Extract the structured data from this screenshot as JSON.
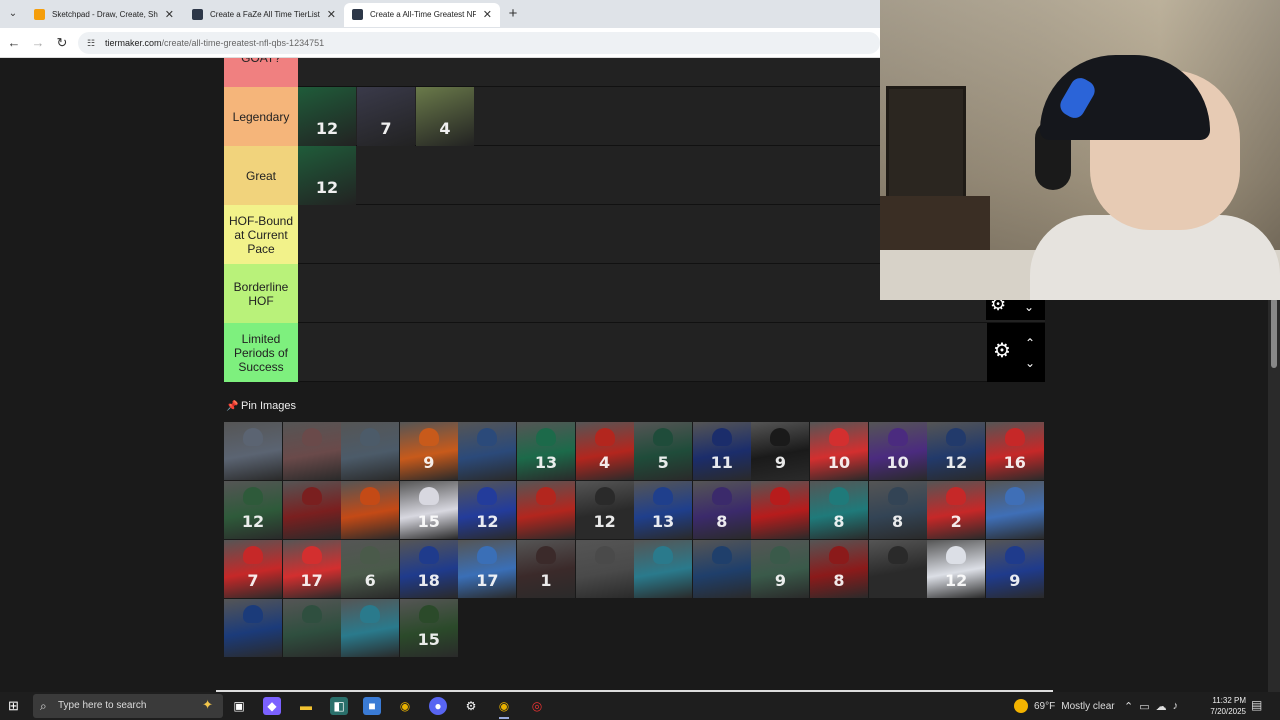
{
  "browser": {
    "tabs": [
      {
        "title": "Sketchpad - Draw, Create, Share",
        "favicon_color": "#f59e0b",
        "active": false
      },
      {
        "title": "Create a FaZe All Time TierList",
        "favicon_color": "#2d3748",
        "active": false
      },
      {
        "title": "Create a All-Time Greatest NFL",
        "favicon_color": "#2d3748",
        "active": true
      }
    ],
    "new_tab": "+",
    "url_domain": "tiermaker.com",
    "url_path": "/create/all-time-greatest-nfl-qbs-1234751"
  },
  "tiers": [
    {
      "label": "GOAT?",
      "color": "#f08080",
      "tiles": []
    },
    {
      "label": "Legendary",
      "color": "#f5b57a",
      "tiles": [
        "12",
        "7",
        "4"
      ]
    },
    {
      "label": "Great",
      "color": "#f1d37c",
      "tiles": [
        "12"
      ]
    },
    {
      "label": "HOF-Bound at Current Pace",
      "color": "#f2f28a",
      "tiles": []
    },
    {
      "label": "Borderline HOF",
      "color": "#b9f27a",
      "tiles": []
    },
    {
      "label": "Limited Periods of Success",
      "color": "#7ef07e",
      "tiles": []
    }
  ],
  "pin_label": "Pin Images",
  "pool": [
    {
      "num": "",
      "color": "#5b6472"
    },
    {
      "num": "",
      "color": "#6a4a4a"
    },
    {
      "num": "",
      "color": "#4c5b69"
    },
    {
      "num": "9",
      "color": "#c85a1b"
    },
    {
      "num": "",
      "color": "#2b4a7a"
    },
    {
      "num": "13",
      "color": "#1c6a4a"
    },
    {
      "num": "4",
      "color": "#b3261e"
    },
    {
      "num": "5",
      "color": "#1f4c3a"
    },
    {
      "num": "11",
      "color": "#1b2d6b"
    },
    {
      "num": "9",
      "color": "#1a1a1a"
    },
    {
      "num": "10",
      "color": "#d32f2f"
    },
    {
      "num": "10",
      "color": "#4b2b7f"
    },
    {
      "num": "12",
      "color": "#223a6b"
    },
    {
      "num": "16",
      "color": "#c62828"
    },
    {
      "num": "12",
      "color": "#2e5a3a"
    },
    {
      "num": "",
      "color": "#7a1f1f"
    },
    {
      "num": "",
      "color": "#c44a16"
    },
    {
      "num": "15",
      "color": "#d8d8e0"
    },
    {
      "num": "12",
      "color": "#233c9b"
    },
    {
      "num": "",
      "color": "#b3261e"
    },
    {
      "num": "12",
      "color": "#2a2a2a"
    },
    {
      "num": "13",
      "color": "#1f3f8c"
    },
    {
      "num": "8",
      "color": "#3b2a6b"
    },
    {
      "num": "",
      "color": "#b71c1c"
    },
    {
      "num": "8",
      "color": "#1f7a7a"
    },
    {
      "num": "8",
      "color": "#334455"
    },
    {
      "num": "2",
      "color": "#c62828"
    },
    {
      "num": "",
      "color": "#3f6fb7"
    },
    {
      "num": "7",
      "color": "#c62828"
    },
    {
      "num": "17",
      "color": "#d32f2f"
    },
    {
      "num": "6",
      "color": "#4a5a4a"
    },
    {
      "num": "18",
      "color": "#1f3b8c"
    },
    {
      "num": "17",
      "color": "#3a6fb7"
    },
    {
      "num": "1",
      "color": "#3b2a2a"
    },
    {
      "num": "",
      "color": "#4a4a4a"
    },
    {
      "num": "",
      "color": "#2a7a8c"
    },
    {
      "num": "",
      "color": "#1f3f6b"
    },
    {
      "num": "9",
      "color": "#3a5a4a"
    },
    {
      "num": "8",
      "color": "#8b1a1a"
    },
    {
      "num": "",
      "color": "#2a2a2a"
    },
    {
      "num": "12",
      "color": "#dcdfe6"
    },
    {
      "num": "9",
      "color": "#1f3b8c"
    },
    {
      "num": "",
      "color": "#1b3b7a"
    },
    {
      "num": "",
      "color": "#2f4f3f"
    },
    {
      "num": "",
      "color": "#2a7a8c"
    },
    {
      "num": "15",
      "color": "#2b4a2a"
    }
  ],
  "row_controls": {
    "gear": "⚙",
    "up": "⌃",
    "down": "⌄"
  },
  "taskbar": {
    "search_placeholder": "Type here to search",
    "weather_temp": "69°F",
    "weather_text": "Mostly clear",
    "time": "11:32 PM",
    "date": "7/20/2025"
  }
}
